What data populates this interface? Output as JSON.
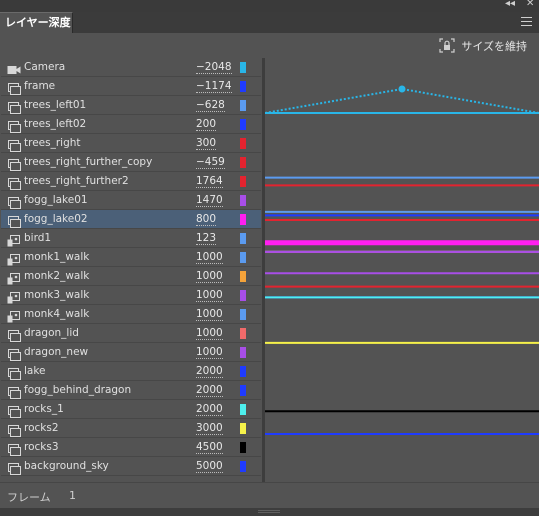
{
  "panel": {
    "tab_label": "レイヤー深度",
    "collapse_glyph": "◂◂",
    "close_glyph": "✕",
    "menu_icon": "hamburger-menu-icon",
    "keep_size_label": "サイズを維持",
    "keep_size_icon": "lock-icon",
    "frame_label": "フレーム",
    "frame_value": "1"
  },
  "layers": [
    {
      "name": "Camera",
      "depth": "−2048",
      "depth_num": -2048,
      "color": "#29b6e8",
      "icon": "camera-icon"
    },
    {
      "name": "frame",
      "depth": "−1174",
      "depth_num": -1174,
      "color": "#1f3bff",
      "icon": "layer-icon"
    },
    {
      "name": "trees_left01",
      "depth": "−628",
      "depth_num": -628,
      "color": "#5b9bf0",
      "icon": "layer-icon"
    },
    {
      "name": "trees_left02",
      "depth": "200",
      "depth_num": 200,
      "color": "#1f3bff",
      "icon": "layer-icon"
    },
    {
      "name": "trees_right",
      "depth": "300",
      "depth_num": 300,
      "color": "#e3232f",
      "icon": "layer-icon"
    },
    {
      "name": "trees_right_further_copy",
      "depth": "−459",
      "depth_num": -459,
      "color": "#e3232f",
      "icon": "layer-icon"
    },
    {
      "name": "trees_right_further2",
      "depth": "1764",
      "depth_num": 1764,
      "color": "#e3232f",
      "icon": "layer-icon"
    },
    {
      "name": "fogg_lake01",
      "depth": "1470",
      "depth_num": 1470,
      "color": "#a84ee8",
      "icon": "layer-icon"
    },
    {
      "name": "fogg_lake02",
      "depth": "800",
      "depth_num": 800,
      "color": "#ff1ff0",
      "icon": "layer-icon",
      "selected": true
    },
    {
      "name": "bird1",
      "depth": "123",
      "depth_num": 123,
      "color": "#5b9bf0",
      "icon": "puppet-icon"
    },
    {
      "name": "monk1_walk",
      "depth": "1000",
      "depth_num": 1000,
      "color": "#5b9bf0",
      "icon": "puppet-icon"
    },
    {
      "name": "monk2_walk",
      "depth": "1000",
      "depth_num": 1000,
      "color": "#f5a33a",
      "icon": "puppet-icon"
    },
    {
      "name": "monk3_walk",
      "depth": "1000",
      "depth_num": 1000,
      "color": "#a84ee8",
      "icon": "puppet-icon"
    },
    {
      "name": "monk4_walk",
      "depth": "1000",
      "depth_num": 1000,
      "color": "#5b9bf0",
      "icon": "puppet-icon"
    },
    {
      "name": "dragon_lid",
      "depth": "1000",
      "depth_num": 1000,
      "color": "#f06a6a",
      "icon": "layer-icon"
    },
    {
      "name": "dragon_new",
      "depth": "1000",
      "depth_num": 1000,
      "color": "#a84ee8",
      "icon": "layer-icon"
    },
    {
      "name": "lake",
      "depth": "2000",
      "depth_num": 2000,
      "color": "#1f3bff",
      "icon": "layer-icon"
    },
    {
      "name": "fogg_behind_dragon",
      "depth": "2000",
      "depth_num": 2000,
      "color": "#1f3bff",
      "icon": "layer-icon"
    },
    {
      "name": "rocks_1",
      "depth": "2000",
      "depth_num": 2000,
      "color": "#4ef0ee",
      "icon": "layer-icon"
    },
    {
      "name": "rocks2",
      "depth": "3000",
      "depth_num": 3000,
      "color": "#f6f24a",
      "icon": "layer-icon"
    },
    {
      "name": "rocks3",
      "depth": "4500",
      "depth_num": 4500,
      "color": "#000000",
      "icon": "layer-icon"
    },
    {
      "name": "background_sky",
      "depth": "5000",
      "depth_num": 5000,
      "color": "#1f3bff",
      "icon": "layer-icon"
    }
  ],
  "preview_lines": [
    {
      "color": "#1f3bff"
    },
    {
      "color": "#5b9bf0"
    },
    {
      "color": "#e3232f"
    },
    {
      "color": "#1f3bff"
    },
    {
      "color": "#5b9bf0"
    },
    {
      "color": "#e3232f"
    },
    {
      "color": "#ff1ff0"
    },
    {
      "color": "#5b9bf0"
    },
    {
      "color": "#a84ee8"
    },
    {
      "color": "#e3232f"
    },
    {
      "color": "#1f3bff"
    },
    {
      "color": "#f6f24a"
    },
    {
      "color": "#000000"
    },
    {
      "color": "#1f3bff"
    }
  ],
  "camera_line_color": "#29b6e8"
}
